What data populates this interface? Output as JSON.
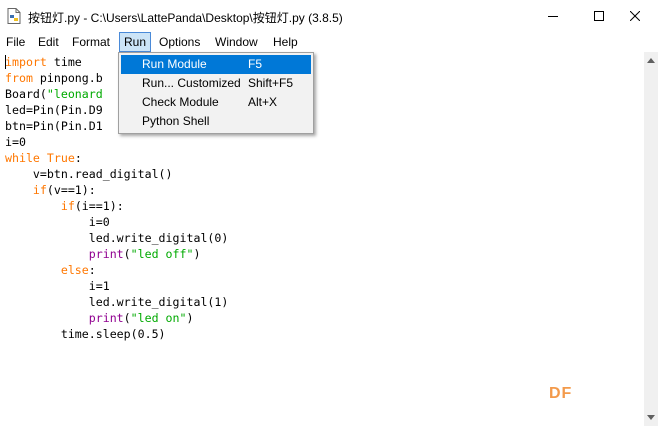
{
  "window": {
    "title": "按钮灯.py - C:\\Users\\LattePanda\\Desktop\\按钮灯.py (3.8.5)",
    "app_icon": "python-file-icon",
    "controls": [
      "minimize-icon",
      "maximize-icon",
      "close-icon"
    ]
  },
  "menubar": {
    "items": [
      {
        "label": "File"
      },
      {
        "label": "Edit"
      },
      {
        "label": "Format"
      },
      {
        "label": "Run",
        "active": true
      },
      {
        "label": "Options"
      },
      {
        "label": "Window"
      },
      {
        "label": "Help"
      }
    ]
  },
  "run_menu": {
    "items": [
      {
        "label": "Run Module",
        "accel": "F5",
        "highlighted": true
      },
      {
        "label": "Run... Customized",
        "accel": "Shift+F5"
      },
      {
        "label": "Check Module",
        "accel": "Alt+X"
      },
      {
        "label": "Python Shell",
        "accel": ""
      }
    ]
  },
  "editor": {
    "lines": [
      [
        {
          "t": "import",
          "c": "kw"
        },
        {
          "t": " time"
        }
      ],
      [
        {
          "t": "from",
          "c": "kw"
        },
        {
          "t": " pinpong.b"
        }
      ],
      [
        {
          "t": "Board("
        },
        {
          "t": "\"leonard",
          "c": "str"
        }
      ],
      [
        {
          "t": "led=Pin(Pin.D9"
        }
      ],
      [
        {
          "t": "btn=Pin(Pin.D1"
        }
      ],
      [
        {
          "t": "i=0"
        }
      ],
      [
        {
          "t": "while",
          "c": "kw"
        },
        {
          "t": " "
        },
        {
          "t": "True",
          "c": "kw"
        },
        {
          "t": ":"
        }
      ],
      [
        {
          "t": "    v=btn.read_digital()"
        }
      ],
      [
        {
          "t": "    "
        },
        {
          "t": "if",
          "c": "kw"
        },
        {
          "t": "(v==1):"
        }
      ],
      [
        {
          "t": "        "
        },
        {
          "t": "if",
          "c": "kw"
        },
        {
          "t": "(i==1):"
        }
      ],
      [
        {
          "t": "            i=0"
        }
      ],
      [
        {
          "t": "            led.write_digital(0)"
        }
      ],
      [
        {
          "t": "            "
        },
        {
          "t": "print",
          "c": "bi"
        },
        {
          "t": "("
        },
        {
          "t": "\"led off\"",
          "c": "str"
        },
        {
          "t": ")"
        }
      ],
      [
        {
          "t": "        "
        },
        {
          "t": "else",
          "c": "kw"
        },
        {
          "t": ":"
        }
      ],
      [
        {
          "t": "            i=1"
        }
      ],
      [
        {
          "t": "            led.write_digital(1)"
        }
      ],
      [
        {
          "t": "            "
        },
        {
          "t": "print",
          "c": "bi"
        },
        {
          "t": "("
        },
        {
          "t": "\"led on\"",
          "c": "str"
        },
        {
          "t": ")"
        }
      ],
      [
        {
          "t": "        time.sleep(0.5)"
        }
      ]
    ]
  },
  "watermark": {
    "text": "DF"
  },
  "colors": {
    "keyword": "#ff7700",
    "string": "#00aa00",
    "builtin": "#900090",
    "menu_highlight": "#0078d7",
    "watermark": "#f39a4b"
  }
}
